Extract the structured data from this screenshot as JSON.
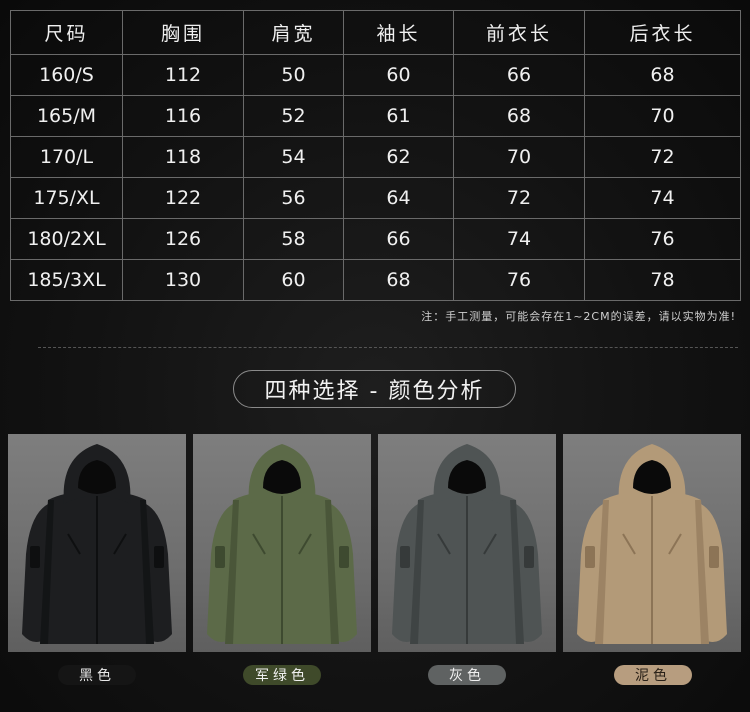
{
  "size_table": {
    "headers": [
      "尺码",
      "胸围",
      "肩宽",
      "袖长",
      "前衣长",
      "后衣长"
    ],
    "rows": [
      [
        "160/S",
        "112",
        "50",
        "60",
        "66",
        "68"
      ],
      [
        "165/M",
        "116",
        "52",
        "61",
        "68",
        "70"
      ],
      [
        "170/L",
        "118",
        "54",
        "62",
        "70",
        "72"
      ],
      [
        "175/XL",
        "122",
        "56",
        "64",
        "72",
        "74"
      ],
      [
        "180/2XL",
        "126",
        "58",
        "66",
        "74",
        "76"
      ],
      [
        "185/3XL",
        "130",
        "60",
        "68",
        "76",
        "78"
      ]
    ]
  },
  "note": "注：手工测量，可能会存在1~2CM的误差，请以实物为准!",
  "section_title": "四种选择 - 颜色分析",
  "colors": [
    {
      "label": "黑色",
      "jacket_color": "#1d1e20",
      "shade": "#0e0f10",
      "pill_bg": "#151515",
      "pill_text": "#e8e8e8"
    },
    {
      "label": "军绿色",
      "jacket_color": "#5c6a48",
      "shade": "#3e4a30",
      "pill_bg": "#3f4a2a",
      "pill_text": "#f0f0f0"
    },
    {
      "label": "灰色",
      "jacket_color": "#4f5454",
      "shade": "#363a3a",
      "pill_bg": "#5f6262",
      "pill_text": "#f0f0f0"
    },
    {
      "label": "泥色",
      "jacket_color": "#b39a78",
      "shade": "#8c7456",
      "pill_bg": "#b79d7f",
      "pill_text": "#2a2118"
    }
  ]
}
